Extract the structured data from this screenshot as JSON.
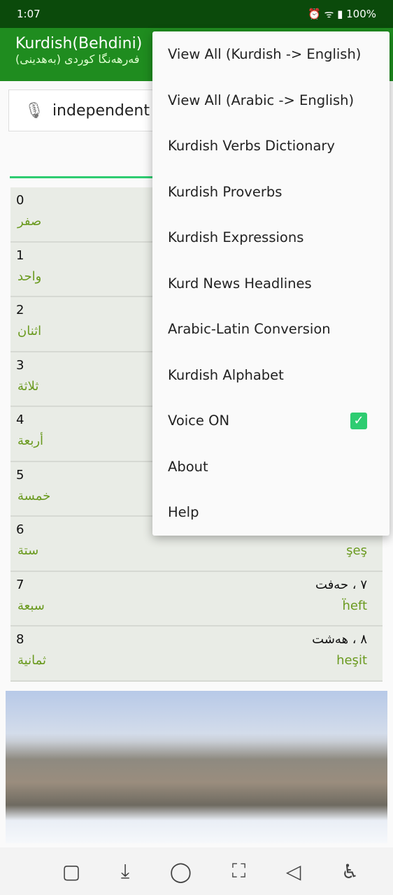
{
  "status": {
    "time": "1:07",
    "battery": "100%"
  },
  "appbar": {
    "title": "Kurdish(Behdini)",
    "subtitle": "فەرهەنگا کوردی (بەهدینی)"
  },
  "search": {
    "value": "independent"
  },
  "rows": [
    {
      "n": "0",
      "ar": "صفر",
      "ku": "",
      "la": ""
    },
    {
      "n": "1",
      "ar": "واحد",
      "ku": "",
      "la": ""
    },
    {
      "n": "2",
      "ar": "اثنان",
      "ku": "",
      "la": ""
    },
    {
      "n": "3",
      "ar": "ثلاثة",
      "ku": "",
      "la": ""
    },
    {
      "n": "4",
      "ar": "أربعة",
      "ku": "",
      "la": ""
    },
    {
      "n": "5",
      "ar": "خمسة",
      "ku": "",
      "la": ""
    },
    {
      "n": "6",
      "ar": "ستة",
      "ku": "",
      "la": "şeş"
    },
    {
      "n": "7",
      "ar": "سبعة",
      "ku": "٧ ، حەفت",
      "la": "ḧeft"
    },
    {
      "n": "8",
      "ar": "ثمانية",
      "ku": "٨ ، هەشت",
      "la": "heşit"
    }
  ],
  "menu": {
    "items": [
      "View All (Kurdish -> English)",
      "View All (Arabic -> English)",
      "Kurdish Verbs Dictionary",
      "Kurdish Proverbs",
      "Kurdish Expressions",
      "Kurd News Headlines",
      "Arabic-Latin Conversion",
      "Kurdish Alphabet",
      "Voice ON",
      "About",
      "Help"
    ],
    "voice_checked": true
  },
  "colors": {
    "statusbar": "#0b4a0b",
    "appbar": "#1f8c1f",
    "accent": "#2ecc71",
    "latin_text": "#6a9a1f"
  }
}
